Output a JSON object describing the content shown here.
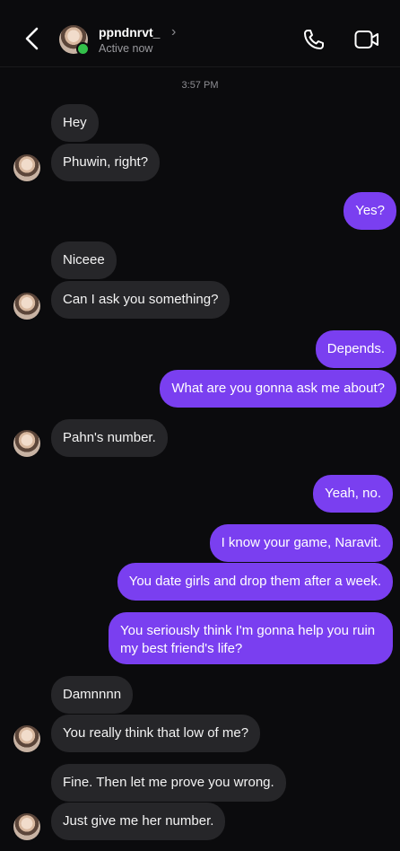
{
  "header": {
    "username": "ppndnrvt_",
    "status": "Active now",
    "icons": {
      "back": "chevron-left-icon",
      "profile_chevron": "chevron-right-icon",
      "call": "phone-icon",
      "video": "video-camera-icon"
    },
    "online_color": "#33c04a"
  },
  "timestamp": "3:57 PM",
  "colors": {
    "background": "#0b0b0d",
    "incoming_bubble": "#262629",
    "outgoing_bubble": "#7a3ff0"
  },
  "messages": [
    {
      "from": "them",
      "text": "Hey"
    },
    {
      "from": "them",
      "text": "Phuwin, right?"
    },
    {
      "from": "me",
      "text": "Yes?"
    },
    {
      "from": "them",
      "text": "Niceee"
    },
    {
      "from": "them",
      "text": "Can I ask you something?"
    },
    {
      "from": "me",
      "text": "Depends."
    },
    {
      "from": "me",
      "text": "What are you gonna ask me about?"
    },
    {
      "from": "them",
      "text": "Pahn's number."
    },
    {
      "from": "me",
      "text": "Yeah, no."
    },
    {
      "from": "me",
      "text": "I know your game, Naravit."
    },
    {
      "from": "me",
      "text": "You date girls and drop them after a week."
    },
    {
      "from": "me",
      "text": "You seriously think I'm gonna help you ruin my best friend's life?"
    },
    {
      "from": "them",
      "text": "Damnnnn"
    },
    {
      "from": "them",
      "text": "You really think that low of me?"
    },
    {
      "from": "them",
      "text": "Fine. Then let me prove you wrong."
    },
    {
      "from": "them",
      "text": "Just give me her number."
    }
  ]
}
